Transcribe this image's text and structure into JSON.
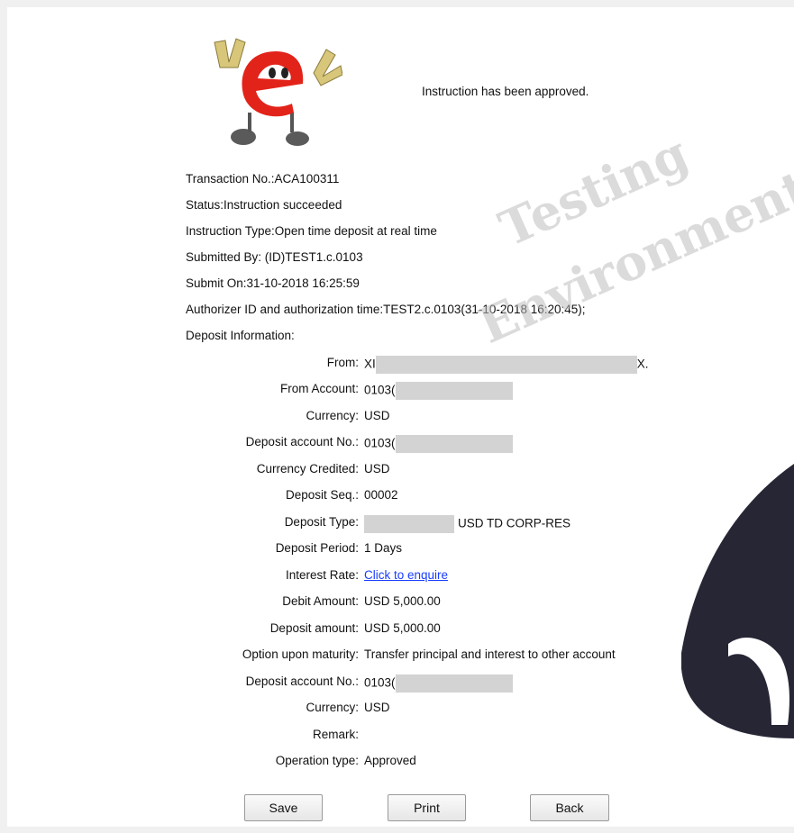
{
  "message": "Instruction has been approved.",
  "summary": [
    "Transaction No.:ACA100311",
    "Status:Instruction succeeded",
    "Instruction Type:Open time deposit at real time",
    "Submitted By: (ID)TEST1.c.0103",
    "Submit On:31-10-2018 16:25:59",
    "Authorizer ID and authorization time:TEST2.c.0103(31-10-2018 16:20:45);",
    "Deposit Information:"
  ],
  "fields": {
    "from_label": "From:",
    "from_prefix": "XI",
    "from_suffix": "X.",
    "from_account_label": "From Account:",
    "from_account_value": "0103(",
    "currency_label": "Currency:",
    "currency_value": "USD",
    "deposit_account_label": "Deposit account No.:",
    "deposit_account_value": "0103(",
    "currency_credited_label": "Currency Credited:",
    "currency_credited_value": "USD",
    "deposit_seq_label": "Deposit Seq.:",
    "deposit_seq_value": "00002",
    "deposit_type_label": "Deposit Type:",
    "deposit_type_value": "USD TD CORP-RES",
    "deposit_period_label": "Deposit Period:",
    "deposit_period_value": "1 Days",
    "interest_rate_label": "Interest Rate:",
    "interest_rate_link": "Click to enquire",
    "debit_amount_label": "Debit Amount:",
    "debit_amount_value": "USD 5,000.00",
    "deposit_amount_label": "Deposit amount:",
    "deposit_amount_value": "USD 5,000.00",
    "option_label": "Option upon maturity:",
    "option_value": "Transfer principal and interest to other account",
    "deposit_account2_label": "Deposit account No.:",
    "deposit_account2_value": "0103(",
    "currency2_label": "Currency:",
    "currency2_value": "USD",
    "remark_label": "Remark:",
    "remark_value": "",
    "operation_type_label": "Operation type:",
    "operation_type_value": "Approved"
  },
  "buttons": {
    "save": "Save",
    "print": "Print",
    "back": "Back"
  },
  "watermark": {
    "line1": "Testing",
    "line2": "Environment"
  },
  "colors": {
    "link": "#1a3cff",
    "mask": "#d3d3d3",
    "blob": "#262635"
  },
  "icons": {
    "logo": "e-mascot-logo-icon"
  }
}
